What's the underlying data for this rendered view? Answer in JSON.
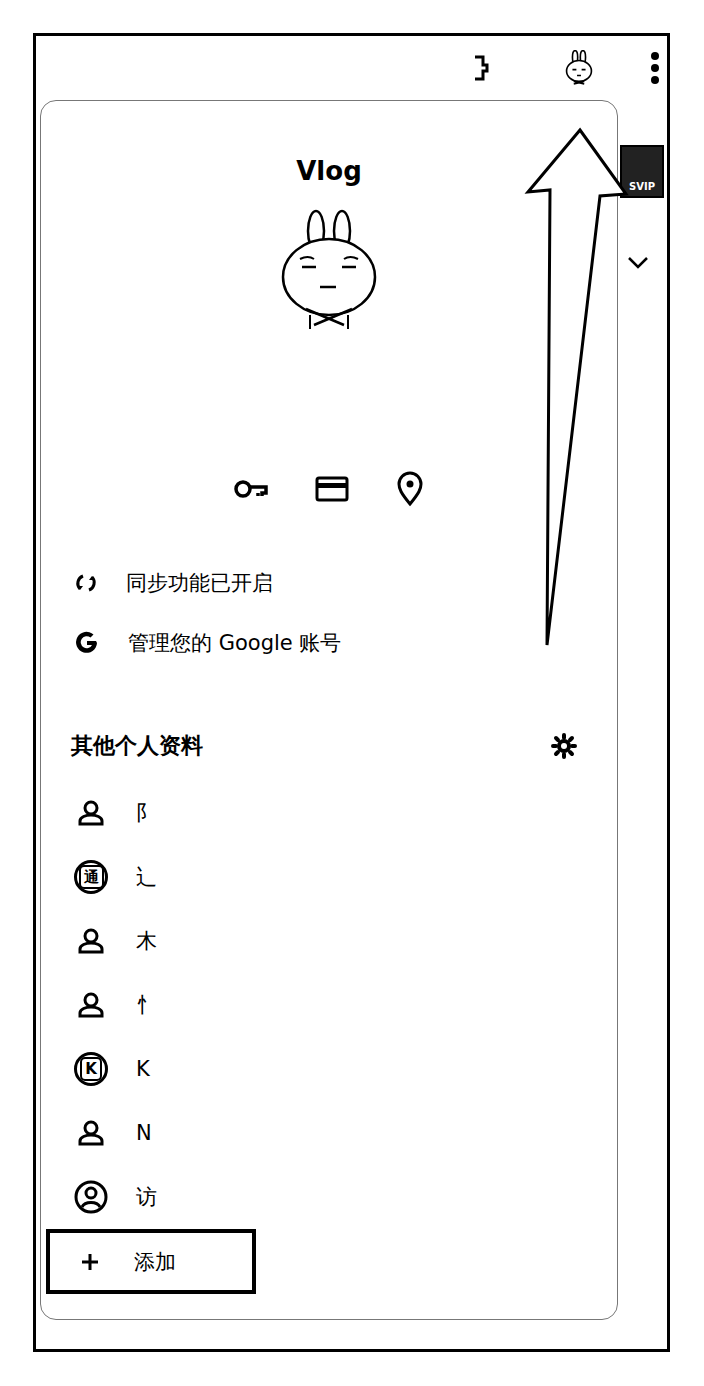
{
  "profile": {
    "name": "Vlog"
  },
  "sync_status": "同步功能已开启",
  "account_link": "管理您的 Google 账号",
  "other_profiles": {
    "title": "其他个人资料",
    "items": [
      {
        "name": "阝",
        "kind": "person",
        "badge": ""
      },
      {
        "name": "辶",
        "kind": "badge",
        "badge": "通"
      },
      {
        "name": "木",
        "kind": "person",
        "badge": ""
      },
      {
        "name": "忄",
        "kind": "person",
        "badge": ""
      },
      {
        "name": "K",
        "kind": "badge",
        "badge": "K"
      },
      {
        "name": "N",
        "kind": "person",
        "badge": ""
      },
      {
        "name": "访",
        "kind": "account",
        "badge": ""
      }
    ]
  },
  "add_button": {
    "label": "添加",
    "highlighted": true
  },
  "side_badge": "SVIP"
}
